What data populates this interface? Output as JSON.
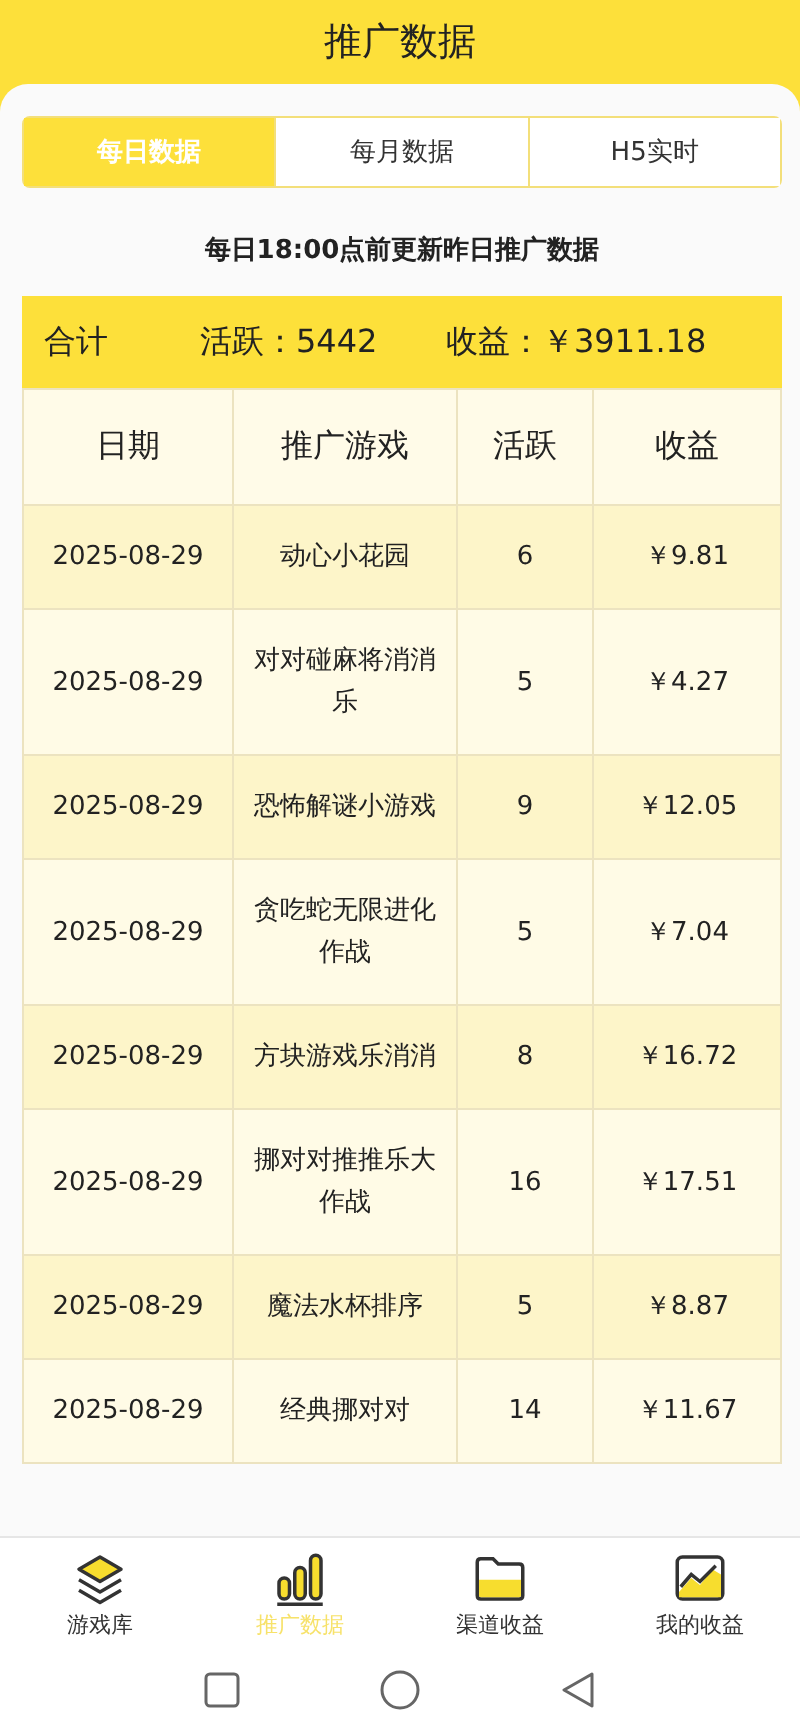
{
  "header": {
    "title": "推广数据"
  },
  "tabs": [
    {
      "label": "每日数据",
      "selected": true
    },
    {
      "label": "每月数据",
      "selected": false
    },
    {
      "label": "H5实时",
      "selected": false
    }
  ],
  "notice": "每日18:00点前更新昨日推广数据",
  "summary": {
    "label": "合计",
    "active": "活跃：5442",
    "income": "收益：￥3911.18"
  },
  "table": {
    "columns": [
      "日期",
      "推广游戏",
      "活跃",
      "收益"
    ],
    "rows": [
      [
        "2025-08-29",
        "动心小花园",
        "6",
        "￥9.81"
      ],
      [
        "2025-08-29",
        "对对碰麻将消消乐",
        "5",
        "￥4.27"
      ],
      [
        "2025-08-29",
        "恐怖解谜小游戏",
        "9",
        "￥12.05"
      ],
      [
        "2025-08-29",
        "贪吃蛇无限进化作战",
        "5",
        "￥7.04"
      ],
      [
        "2025-08-29",
        "方块游戏乐消消",
        "8",
        "￥16.72"
      ],
      [
        "2025-08-29",
        "挪对对推推乐大作战",
        "16",
        "￥17.51"
      ],
      [
        "2025-08-29",
        "魔法水杯排序",
        "5",
        "￥8.87"
      ],
      [
        "2025-08-29",
        "经典挪对对",
        "14",
        "￥11.67"
      ]
    ]
  },
  "bottom_nav": [
    {
      "label": "游戏库",
      "kind": "layers",
      "selected": false
    },
    {
      "label": "推广数据",
      "kind": "bars",
      "selected": true
    },
    {
      "label": "渠道收益",
      "kind": "folder",
      "selected": false
    },
    {
      "label": "我的收益",
      "kind": "chart",
      "selected": false
    }
  ]
}
